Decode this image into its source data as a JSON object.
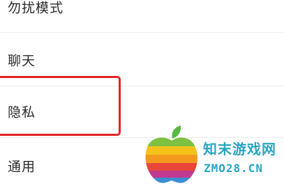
{
  "settings": {
    "items": [
      {
        "label": "勿扰模式"
      },
      {
        "label": "聊天"
      },
      {
        "label": "隐私"
      },
      {
        "label": "通用"
      }
    ]
  },
  "highlight": {
    "color": "#e32424",
    "target": "隐私"
  },
  "watermark": {
    "title": "知末游戏网",
    "domain": "ZMO28.CN",
    "color": "#2aa5c2",
    "logo_icon": "colorful-apple-logo"
  }
}
